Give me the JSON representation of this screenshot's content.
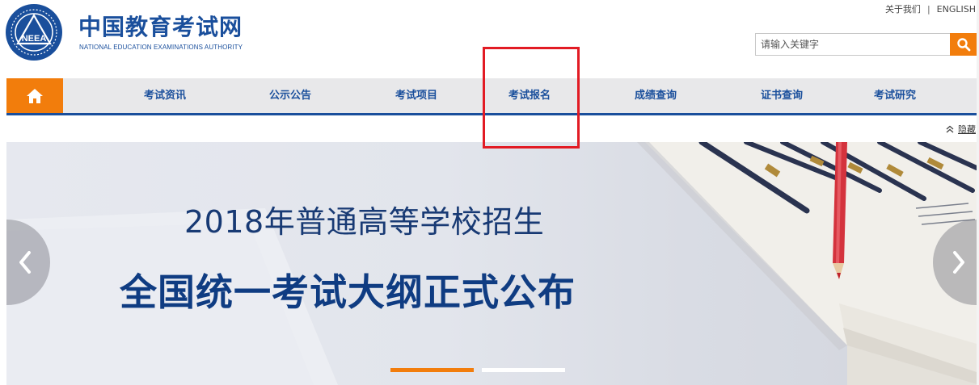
{
  "header": {
    "logo_text_cn": "中国教育考试网",
    "logo_text_en": "NATIONAL EDUCATION EXAMINATIONS AUTHORITY",
    "emblem_text": "NEEA",
    "top_links": {
      "about": "关于我们",
      "separator": "|",
      "english": "ENGLISH"
    },
    "search": {
      "placeholder": "请输入关键字",
      "value": ""
    }
  },
  "nav": {
    "home_icon": "home-icon",
    "items": [
      {
        "label": "考试资讯"
      },
      {
        "label": "公示公告"
      },
      {
        "label": "考试项目"
      },
      {
        "label": "考试报名"
      },
      {
        "label": "成绩查询"
      },
      {
        "label": "证书查询"
      },
      {
        "label": "考试研究"
      }
    ],
    "hide_label": "隐藏"
  },
  "banner": {
    "subtitle": "2018年普通高等学校招生",
    "title": "全国统一考试大纲正式公布",
    "active_slide": 1,
    "slide_count": 2
  },
  "colors": {
    "brand_blue": "#1a4f9c",
    "accent_orange": "#f27d0c",
    "highlight_red": "#e21b24",
    "nav_background": "#e8e8ea"
  }
}
